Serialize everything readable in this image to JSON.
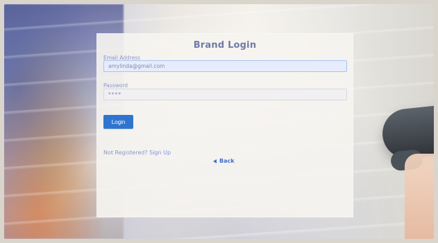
{
  "login": {
    "title": "Brand Login",
    "email_label": "Email Address",
    "email_value": "amylinda@gmail.com",
    "password_label": "Password",
    "password_value": "****",
    "login_button": "Login",
    "register_prompt": "Not Registered?",
    "signup_link": "Sign Up",
    "back_link": "Back"
  }
}
